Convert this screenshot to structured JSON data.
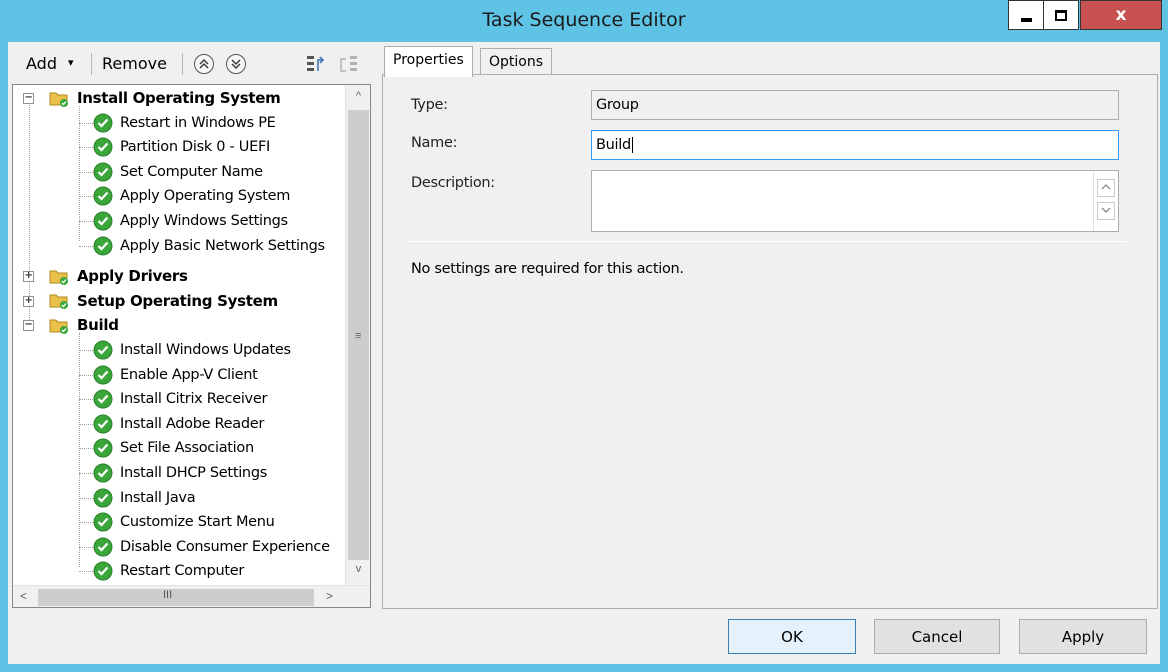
{
  "window": {
    "title": "Task Sequence Editor",
    "controls": {
      "minimize_icon": "minimize-icon",
      "maximize_icon": "maximize-icon",
      "close_label": "x"
    }
  },
  "toolbar": {
    "add_label": "Add",
    "add_caret": "▾",
    "remove_label": "Remove",
    "move_up_icon": "move-up-icon",
    "move_down_icon": "move-down-icon"
  },
  "tree": {
    "groups": [
      {
        "label": "Install Operating System",
        "expanded": true,
        "expander": "−",
        "items": [
          "Restart in Windows PE",
          "Partition Disk 0 - UEFI",
          "Set Computer Name",
          "Apply Operating System",
          "Apply Windows Settings",
          "Apply Basic Network Settings"
        ]
      },
      {
        "label": "Apply Drivers",
        "expanded": false,
        "expander": "+",
        "items": []
      },
      {
        "label": "Setup Operating System",
        "expanded": false,
        "expander": "+",
        "items": []
      },
      {
        "label": "Build",
        "expanded": true,
        "expander": "−",
        "items": [
          "Install Windows Updates",
          "Enable App-V Client",
          "Install Citrix Receiver",
          "Install Adobe Reader",
          "Set File Association",
          "Install DHCP Settings",
          "Install Java",
          "Customize Start Menu",
          "Disable Consumer Experience",
          "Restart Computer"
        ]
      }
    ],
    "scroll": {
      "up": "^",
      "down": "v",
      "left": "<",
      "right": ">",
      "grip_v": "≡",
      "grip_h": "III"
    }
  },
  "tabs": [
    {
      "label": "Properties",
      "active": true
    },
    {
      "label": "Options",
      "active": false
    }
  ],
  "properties": {
    "type_label": "Type:",
    "type_value": "Group",
    "name_label": "Name:",
    "name_value": "Build",
    "description_label": "Description:",
    "description_value": "",
    "note": "No settings are required  for this action."
  },
  "buttons": {
    "ok": "OK",
    "cancel": "Cancel",
    "apply": "Apply"
  },
  "colors": {
    "titlebar": "#5fc3e6",
    "close": "#c75050",
    "check": "#3aa63a",
    "folder": "#e8c04a"
  }
}
